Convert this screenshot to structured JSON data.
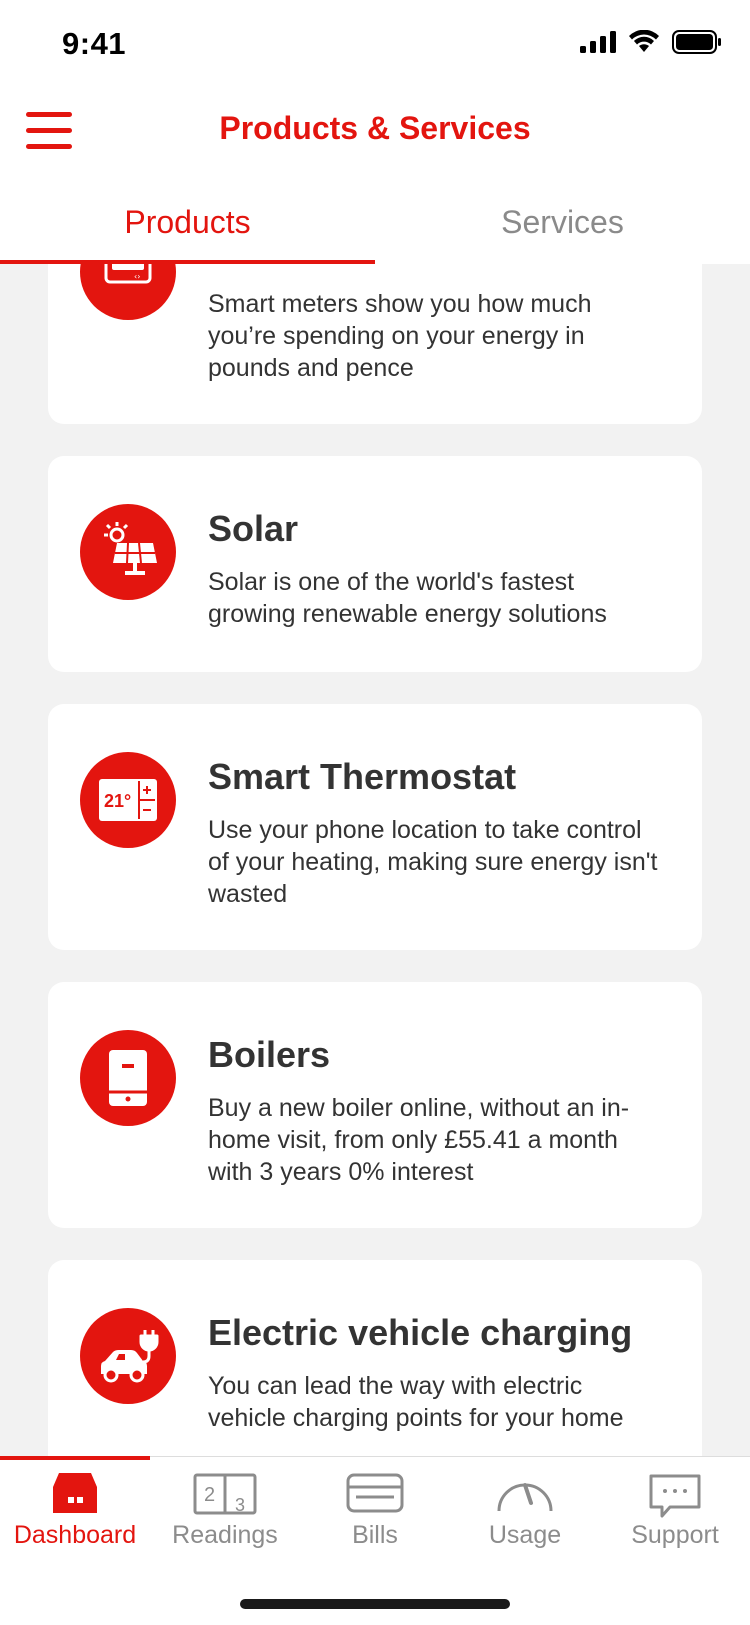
{
  "status_bar": {
    "time": "9:41"
  },
  "header": {
    "title": "Products & Services"
  },
  "tabs": [
    {
      "label": "Products",
      "active": true
    },
    {
      "label": "Services",
      "active": false
    }
  ],
  "cards": [
    {
      "title": "",
      "description": "Smart meters show you how much you’re spending on your energy in pounds and pence",
      "icon": "smart-meter-icon"
    },
    {
      "title": "Solar",
      "description": "Solar is one of the world's fastest growing renewable energy solutions",
      "icon": "solar-panel-icon"
    },
    {
      "title": "Smart Thermostat",
      "description": "Use your phone location to take control of your heating, making sure energy isn't wasted",
      "icon": "thermostat-icon",
      "icon_text": "21°"
    },
    {
      "title": "Boilers",
      "description": "Buy a new boiler online, without an in-home visit, from only £55.41 a month with 3 years 0% interest",
      "icon": "boiler-icon"
    },
    {
      "title": "Electric vehicle charging",
      "description": "You can lead the way with electric vehicle charging points for your home",
      "icon": "ev-charging-icon"
    }
  ],
  "bottom_nav": [
    {
      "label": "Dashboard",
      "icon": "home-icon",
      "active": true
    },
    {
      "label": "Readings",
      "icon": "meter-readings-icon",
      "active": false,
      "icon_digits": [
        "2",
        "3"
      ]
    },
    {
      "label": "Bills",
      "icon": "bill-icon",
      "active": false
    },
    {
      "label": "Usage",
      "icon": "gauge-icon",
      "active": false
    },
    {
      "label": "Support",
      "icon": "chat-icon",
      "active": false
    }
  ],
  "colors": {
    "accent": "#e3150f",
    "background": "#f2f2f2",
    "text": "#333333",
    "inactive": "#8c8c8c"
  }
}
